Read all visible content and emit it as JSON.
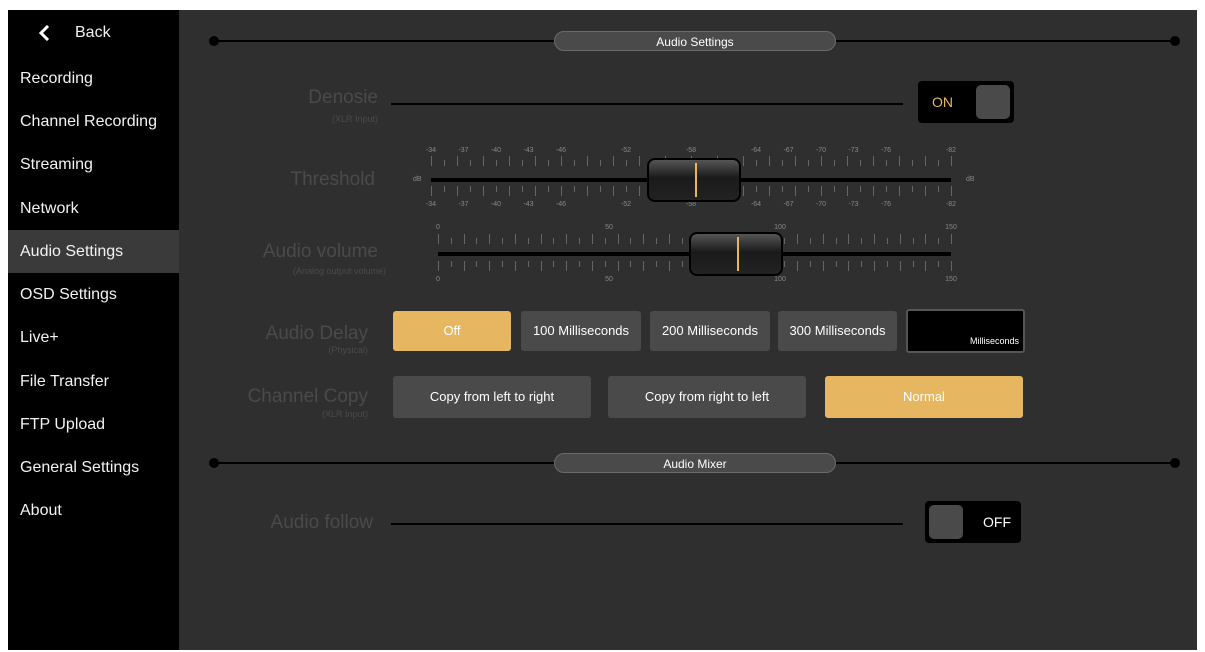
{
  "sidebar": {
    "back_label": "Back",
    "items": [
      {
        "label": "Recording"
      },
      {
        "label": "Channel Recording"
      },
      {
        "label": "Streaming"
      },
      {
        "label": "Network"
      },
      {
        "label": "Audio Settings",
        "active": true
      },
      {
        "label": "OSD Settings"
      },
      {
        "label": "Live+"
      },
      {
        "label": "File Transfer"
      },
      {
        "label": "FTP Upload"
      },
      {
        "label": "General Settings"
      },
      {
        "label": "About"
      }
    ]
  },
  "sections": {
    "audio_settings": "Audio Settings",
    "audio_mixer": "Audio Mixer"
  },
  "denoise": {
    "label": "Denosie",
    "sub": "(XLR Input)",
    "state": "ON"
  },
  "threshold": {
    "label": "Threshold",
    "unit": "dB",
    "ticks": [
      "-34",
      "-37",
      "-40",
      "-43",
      "-46",
      "-52",
      "-58",
      "-64",
      "-67",
      "-70",
      "-73",
      "-76",
      "-82"
    ],
    "value": "-58"
  },
  "audio_volume": {
    "label": "Audio volume",
    "sub": "(Analog output volume)",
    "ticks": [
      "0",
      "50",
      "100",
      "150"
    ],
    "value": 87
  },
  "audio_delay": {
    "label": "Audio Delay",
    "sub": "(Physical)",
    "options": [
      "Off",
      "100 Milliseconds",
      "200 Milliseconds",
      "300 Milliseconds"
    ],
    "selected": "Off",
    "custom_unit": "Milliseconds"
  },
  "channel_copy": {
    "label": "Channel Copy",
    "sub": "(XLR Input)",
    "options": [
      "Copy from left to right",
      "Copy from right to left",
      "Normal"
    ],
    "selected": "Normal"
  },
  "audio_follow": {
    "label": "Audio follow",
    "state": "OFF"
  },
  "colors": {
    "accent": "#e6b760",
    "panel": "#2f2f2f",
    "sidebar": "#000000"
  }
}
